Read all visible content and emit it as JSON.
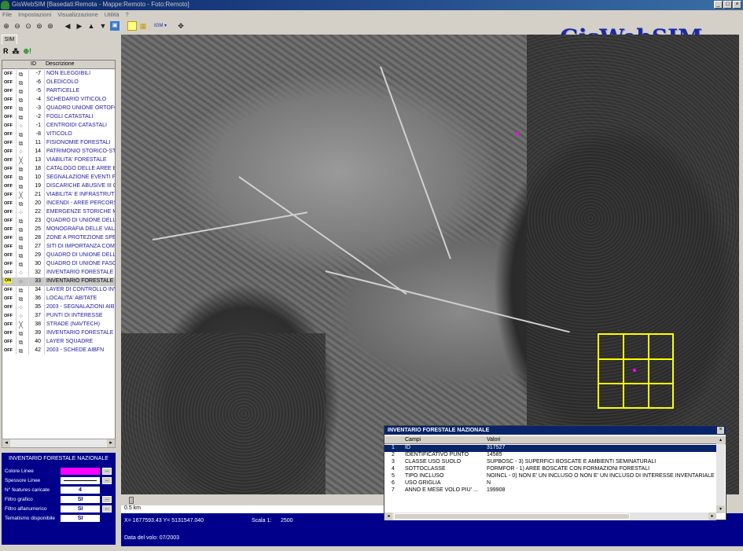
{
  "window": {
    "title": "GisWebSIM [Basedati:Remota - Mappe:Remoto - Foto:Remoto]",
    "controls": [
      "_",
      "□",
      "×"
    ]
  },
  "menu": [
    "File",
    "Impostazioni",
    "Visualizzazione",
    "Utilità",
    "?"
  ],
  "toolbar": {
    "brand": "GisWebSIM",
    "igm_label": "IGM"
  },
  "panel": {
    "tab": "SIM",
    "tools": [
      "R",
      "⁂",
      "⊕!"
    ],
    "columns": {
      "id": "ID",
      "desc": "Descrizione"
    },
    "layers": [
      {
        "state": "OFF",
        "icon": "poly",
        "id": "-7",
        "desc": "NON ELEGGIBILI"
      },
      {
        "state": "OFF",
        "icon": "poly",
        "id": "-6",
        "desc": "OLEDICOLO"
      },
      {
        "state": "OFF",
        "icon": "poly",
        "id": "-5",
        "desc": "PARTICELLE"
      },
      {
        "state": "OFF",
        "icon": "poly",
        "id": "-4",
        "desc": "SCHEDARIO VITICOLO"
      },
      {
        "state": "OFF",
        "icon": "poly",
        "id": "-3",
        "desc": "QUADRO UNIONE ORTOFO"
      },
      {
        "state": "OFF",
        "icon": "poly",
        "id": "-2",
        "desc": "FOGLI CATASTALI"
      },
      {
        "state": "OFF",
        "icon": "point",
        "id": "-1",
        "desc": "CENTROIDI CATASTALI"
      },
      {
        "state": "OFF",
        "icon": "poly",
        "id": "-8",
        "desc": "VITICOLO"
      },
      {
        "state": "OFF",
        "icon": "poly",
        "id": "11",
        "desc": "FISIONOMIE FORESTALI"
      },
      {
        "state": "OFF",
        "icon": "point",
        "id": "14",
        "desc": "PATRIMONIO STORICO-ST"
      },
      {
        "state": "OFF",
        "icon": "line",
        "id": "13",
        "desc": "VIABILITA' FORESTALE"
      },
      {
        "state": "OFF",
        "icon": "poly",
        "id": "18",
        "desc": "CATALOGO DELLE AREE B"
      },
      {
        "state": "OFF",
        "icon": "poly",
        "id": "10",
        "desc": "SEGNALAZIONE EVENTI FI"
      },
      {
        "state": "OFF",
        "icon": "poly",
        "id": "19",
        "desc": "DISCARICHE ABUSIVE III C"
      },
      {
        "state": "OFF",
        "icon": "line",
        "id": "21",
        "desc": "VIABILITA' E INFRASTRUT"
      },
      {
        "state": "OFF",
        "icon": "poly",
        "id": "20",
        "desc": "INCENDI - AREE PERCORS"
      },
      {
        "state": "OFF",
        "icon": "point",
        "id": "22",
        "desc": "EMERGENZE STORICHE M"
      },
      {
        "state": "OFF",
        "icon": "poly",
        "id": "23",
        "desc": "QUADRO DI UNIONE DELL"
      },
      {
        "state": "OFF",
        "icon": "poly",
        "id": "25",
        "desc": "MONOGRAFIA DELLE VALA"
      },
      {
        "state": "OFF",
        "icon": "poly",
        "id": "28",
        "desc": "ZONE A PROTEZIONE SPE"
      },
      {
        "state": "OFF",
        "icon": "poly",
        "id": "27",
        "desc": "SITI DI IMPORTANZA COMI"
      },
      {
        "state": "OFF",
        "icon": "poly",
        "id": "29",
        "desc": "QUADRO DI UNIONE DELL"
      },
      {
        "state": "OFF",
        "icon": "poly",
        "id": "30",
        "desc": "QUADRO DI UNIONE  FASC"
      },
      {
        "state": "OFF",
        "icon": "point",
        "id": "32",
        "desc": "INVENTARIO FORESTALE I"
      },
      {
        "state": "ON",
        "icon": "point",
        "id": "33",
        "desc": "INVENTARIO FORESTALE I"
      },
      {
        "state": "OFF",
        "icon": "poly",
        "id": "34",
        "desc": "LAYER DI CONTROLLO INV"
      },
      {
        "state": "OFF",
        "icon": "poly",
        "id": "36",
        "desc": "LOCALITA' ABITATE"
      },
      {
        "state": "OFF",
        "icon": "point",
        "id": "35",
        "desc": "2003 - SEGNALAZIONI AIB I"
      },
      {
        "state": "OFF",
        "icon": "point",
        "id": "37",
        "desc": "PUNTI DI INTERESSE"
      },
      {
        "state": "OFF",
        "icon": "line",
        "id": "38",
        "desc": "STRADE (NAVTECH)"
      },
      {
        "state": "OFF",
        "icon": "poly",
        "id": "39",
        "desc": "INVENTARIO FORESTALE I"
      },
      {
        "state": "OFF",
        "icon": "poly",
        "id": "40",
        "desc": "LAYER SQUADRE"
      },
      {
        "state": "OFF",
        "icon": "poly",
        "id": "42",
        "desc": "2003 - SCHEDE AIBFN"
      }
    ],
    "selected_index": 24
  },
  "info": {
    "title": "INVENTARIO FORESTALE NAZIONALE",
    "rows": [
      {
        "label": "Colore Linee",
        "value": "",
        "kind": "color",
        "color": "#ff00ff"
      },
      {
        "label": "Spessore Linee",
        "value": "",
        "kind": "line"
      },
      {
        "label": "N° features caricate",
        "value": "4",
        "kind": "text"
      },
      {
        "label": "Filtro grafico",
        "value": "SI",
        "kind": "text"
      },
      {
        "label": "Filtro alfanumerico",
        "value": "SI",
        "kind": "text"
      },
      {
        "label": "Tematismo disponibile",
        "value": "SI",
        "kind": "text"
      }
    ],
    "button_label": "..."
  },
  "map": {
    "scalebar": "0.5 km"
  },
  "status": {
    "coords": "X= 1677593.43  Y= 5131547.040",
    "scale_label": "Scala 1:",
    "scale_value": "2500",
    "date": "Data del volo: 07/2003"
  },
  "popup": {
    "title": "INVENTARIO FORESTALE NAZIONALE",
    "close": "×",
    "columns": {
      "campi": "Campi",
      "valori": "Valori"
    },
    "rows": [
      {
        "n": "1",
        "campo": "ID",
        "valore": "317527"
      },
      {
        "n": "2",
        "campo": "IDENTIFICATIVO PUNTO",
        "valore": "14585"
      },
      {
        "n": "3",
        "campo": "CLASSE USO SUOLO",
        "valore": "SUPBOSC - 3) SUPERFICI BOSCATE E AMBIENTI SEMINATURALI"
      },
      {
        "n": "4",
        "campo": "SOTTOCLASSE",
        "valore": "FORMFOR - 1) AREE BOSCATE CON FORMAZIONI FORESTALI"
      },
      {
        "n": "5",
        "campo": "TIPO INCLUSO",
        "valore": "NOINCL - 0) NON E' UN INCLUSO O NON E' UN INCLUSO DI INTERESSE INVENTARIALE"
      },
      {
        "n": "6",
        "campo": "USO GRIGLIA",
        "valore": "N"
      },
      {
        "n": "7",
        "campo": "ANNO E MESE VOLO PIU' ...",
        "valore": "199908"
      }
    ]
  }
}
